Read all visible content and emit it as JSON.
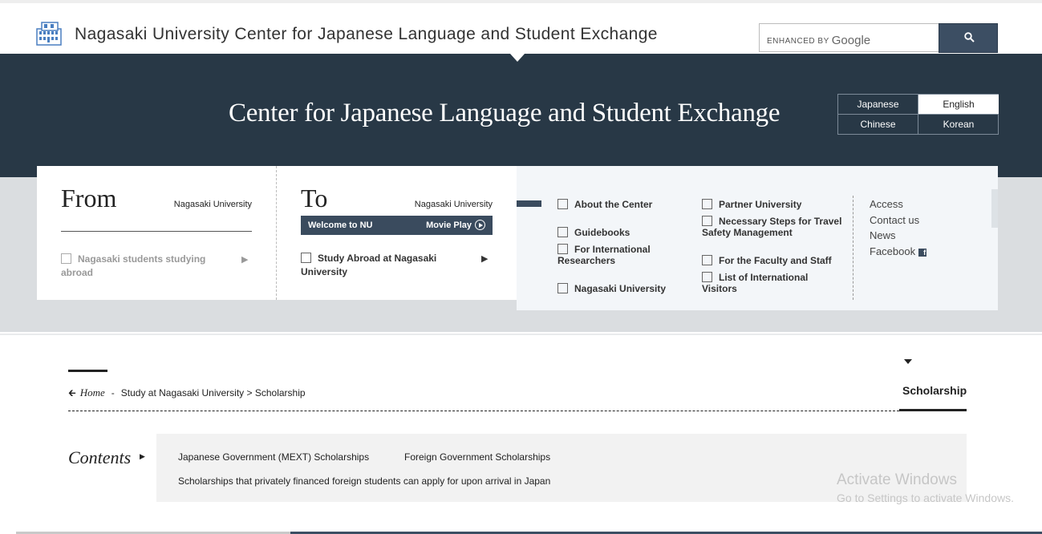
{
  "header": {
    "site_title": "Nagasaki University Center for Japanese Language and Student Exchange",
    "logo_icon": "university-building-logo",
    "search": {
      "brand_prefix": "ENHANCED BY",
      "brand_name": "Google",
      "placeholder": "",
      "button_icon": "search-icon"
    }
  },
  "hero": {
    "title": "Center for Japanese Language and Student Exchange",
    "languages": [
      "Japanese",
      "English",
      "Chinese",
      "Korean"
    ],
    "selected_language": "English"
  },
  "from_panel": {
    "heading": "From",
    "sub": "Nagasaki University",
    "item": "Nagasaki students studying abroad",
    "arrow": "▶"
  },
  "to_panel": {
    "heading": "To",
    "sub": "Nagasaki University",
    "bar_left": "Welcome to NU",
    "bar_right": "Movie Play",
    "item": "Study Abroad at Nagasaki University",
    "arrow": "▶"
  },
  "menu": {
    "col1": [
      "About the Center",
      "Guidebooks",
      "For International Researchers",
      "Nagasaki University"
    ],
    "col2": [
      "Partner University",
      "Necessary Steps for Travel Safety Management",
      "For the Faculty and Staff",
      "List of International Visitors"
    ],
    "links": [
      "Access",
      "Contact us",
      "News",
      "Facebook"
    ]
  },
  "breadcrumb": {
    "home": "Home",
    "dash": "-",
    "path": "Study at Nagasaki University > Scholarship",
    "active_tab": "Scholarship"
  },
  "contents": {
    "label": "Contents",
    "links": [
      "Japanese Government (MEXT) Scholarships",
      "Foreign Government Scholarships",
      "Scholarships that privately financed foreign students can apply for upon arrival in Japan"
    ]
  },
  "watermark": {
    "line1": "Activate Windows",
    "line2": "Go to Settings to activate Windows."
  },
  "colors": {
    "hero_bg": "#283846",
    "accent": "#3a4b5e",
    "grey_band": "#dadde0"
  }
}
